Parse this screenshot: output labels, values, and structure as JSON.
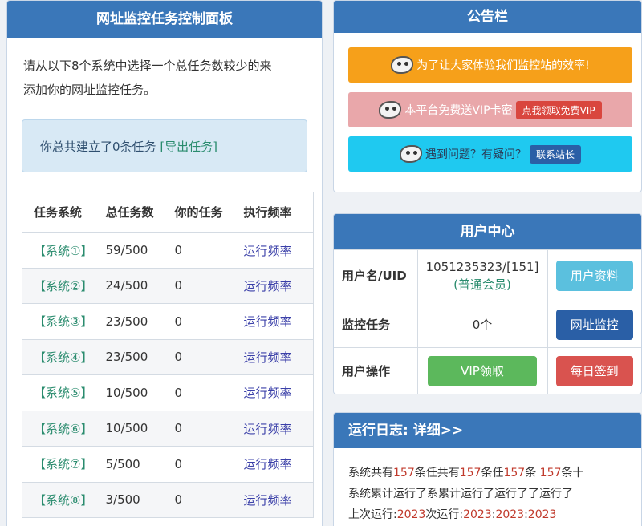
{
  "left_panel": {
    "title": "网址监控任务控制面板",
    "intro_line1": "请从以下8个系统中选择一个总任务数较少的来",
    "intro_line2": "添加你的网址监控任务。",
    "summary_text": "你总共建立了0条任务 ",
    "export_link": "[导出任务]",
    "table": {
      "headers": [
        "任务系统",
        "总任务数",
        "你的任务",
        "执行频率"
      ],
      "rows": [
        {
          "system": "【系统①】",
          "total": "59/500",
          "mine": "0",
          "freq": "运行频率"
        },
        {
          "system": "【系统②】",
          "total": "24/500",
          "mine": "0",
          "freq": "运行频率"
        },
        {
          "system": "【系统③】",
          "total": "23/500",
          "mine": "0",
          "freq": "运行频率"
        },
        {
          "system": "【系统④】",
          "total": "23/500",
          "mine": "0",
          "freq": "运行频率"
        },
        {
          "system": "【系统⑤】",
          "total": "10/500",
          "mine": "0",
          "freq": "运行频率"
        },
        {
          "system": "【系统⑥】",
          "total": "10/500",
          "mine": "0",
          "freq": "运行频率"
        },
        {
          "system": "【系统⑦】",
          "total": "5/500",
          "mine": "0",
          "freq": "运行频率"
        },
        {
          "system": "【系统⑧】",
          "total": "3/500",
          "mine": "0",
          "freq": "运行频率"
        }
      ]
    }
  },
  "notice_panel": {
    "title": "公告栏",
    "banner1": "为了让大家体验我们监控站的效率!",
    "banner2": "本平台免费送VIP卡密",
    "banner2_button": "点我领取免费VIP",
    "banner3": "遇到问题？有疑问？",
    "banner3_button": "联系站长",
    "mascot_icon": "mascot-icon"
  },
  "user_panel": {
    "title": "用户中心",
    "username_label": "用户名/UID",
    "username_value": "1051235323/[151]",
    "member_level": "(普通会员)",
    "profile_button": "用户资料",
    "tasks_label": "监控任务",
    "tasks_value": "0个",
    "monitor_button": "网址监控",
    "ops_label": "用户操作",
    "vip_button": "VIP领取",
    "signin_button": "每日签到"
  },
  "log_panel": {
    "title": "运行日志: 详细>>",
    "line1_prefix": "系统共有",
    "line1_num1": "157",
    "line1_mid1": "条任共有",
    "line1_num2": "157",
    "line1_mid2": "条任",
    "line1_num3": "157",
    "line1_mid3": "条 ",
    "line1_num4": "157",
    "line1_suffix": "条十",
    "line2": "系统累计运行了系累计运行了运行了了运行了",
    "line3_prefix": "上次运行:",
    "line3_num1": "2023",
    "line3_mid": "次运行:",
    "line3_num2": "2023",
    "line3_sep": ":",
    "line3_num3": "2023",
    "line3_sep2": ":",
    "line3_num4": "2023"
  },
  "colors": {
    "header_blue": "#3a77b9",
    "green_link": "#2a8c6e",
    "orange_banner": "#f6a01a",
    "pink_banner": "#e9a7aa",
    "cyan_banner": "#1fc9f0"
  }
}
